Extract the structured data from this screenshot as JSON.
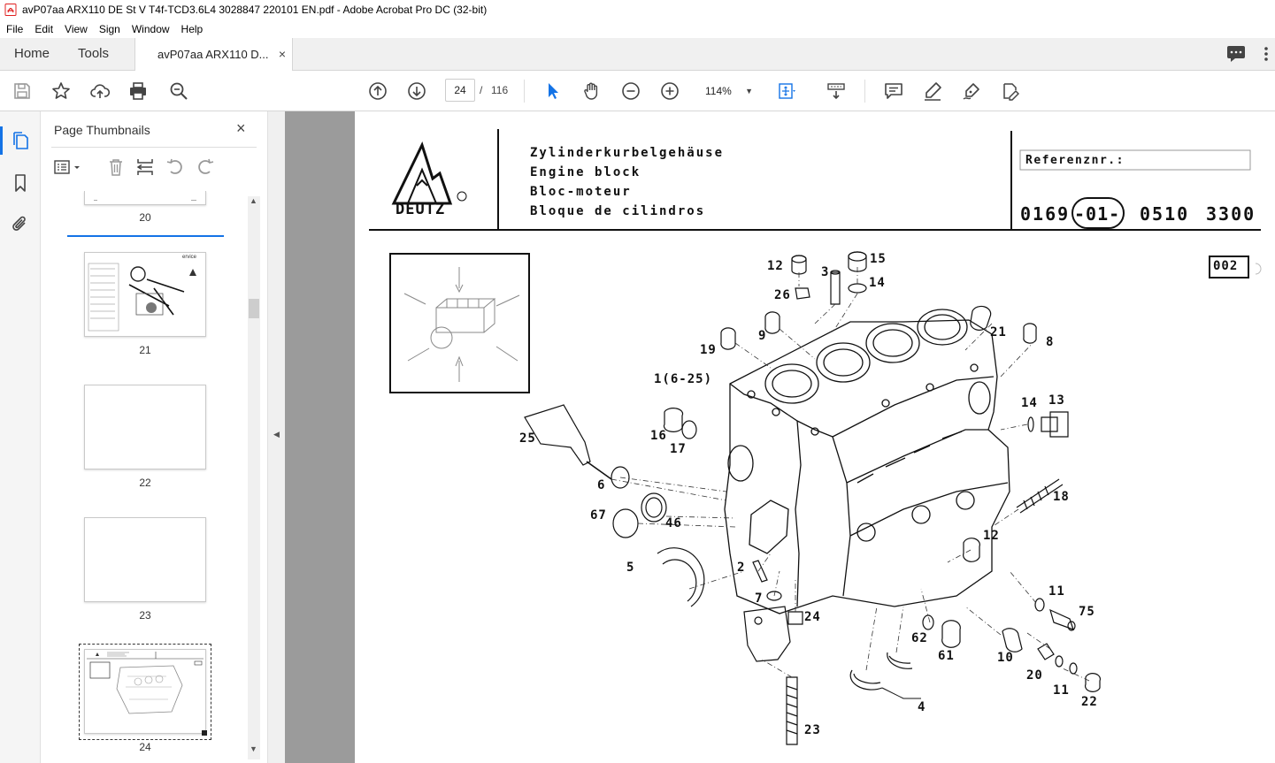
{
  "window": {
    "title": "avP07aa ARX110 DE St V T4f-TCD3.6L4 3028847 220101 EN.pdf - Adobe Acrobat Pro DC (32-bit)"
  },
  "menu": [
    "File",
    "Edit",
    "View",
    "Sign",
    "Window",
    "Help"
  ],
  "tabs": {
    "home": "Home",
    "tools": "Tools",
    "document": "avP07aa ARX110 D...",
    "close": "×"
  },
  "toolbar": {
    "current_page": "24",
    "page_separator": "/",
    "total_pages": "116",
    "zoom": "114%"
  },
  "sidebar": {
    "title": "Page Thumbnails",
    "close": "×",
    "thumbnails": [
      "20",
      "21",
      "22",
      "23",
      "24"
    ],
    "thumb21_text": "ervice"
  },
  "sheet": {
    "brand": "DEUTZ",
    "titles": [
      "Zylinderkurbelgehäuse",
      "Engine block",
      "Bloc-moteur",
      "Bloque de cilindros"
    ],
    "reference_label": "Referenznr.:",
    "ref_part1": "0169",
    "ref_part2": "-01-",
    "ref_part3": "0510",
    "ref_part4": "3300",
    "page_code": "002"
  },
  "callouts": [
    {
      "id": "c12a",
      "text": "12"
    },
    {
      "id": "c3",
      "text": "3"
    },
    {
      "id": "c15",
      "text": "15"
    },
    {
      "id": "c14a",
      "text": "14"
    },
    {
      "id": "c26",
      "text": "26"
    },
    {
      "id": "c9",
      "text": "9"
    },
    {
      "id": "c21",
      "text": "21"
    },
    {
      "id": "c8",
      "text": "8"
    },
    {
      "id": "c19",
      "text": "19"
    },
    {
      "id": "c1",
      "text": "1(6-25)"
    },
    {
      "id": "c14b",
      "text": "14"
    },
    {
      "id": "c13",
      "text": "13"
    },
    {
      "id": "c25",
      "text": "25"
    },
    {
      "id": "c16",
      "text": "16"
    },
    {
      "id": "c17",
      "text": "17"
    },
    {
      "id": "c6",
      "text": "6"
    },
    {
      "id": "c18",
      "text": "18"
    },
    {
      "id": "c67",
      "text": "67"
    },
    {
      "id": "c46",
      "text": "46"
    },
    {
      "id": "c12b",
      "text": "12"
    },
    {
      "id": "c5",
      "text": "5"
    },
    {
      "id": "c2",
      "text": "2"
    },
    {
      "id": "c11a",
      "text": "11"
    },
    {
      "id": "c7",
      "text": "7"
    },
    {
      "id": "c24",
      "text": "24"
    },
    {
      "id": "c75",
      "text": "75"
    },
    {
      "id": "c62",
      "text": "62"
    },
    {
      "id": "c61",
      "text": "61"
    },
    {
      "id": "c10",
      "text": "10"
    },
    {
      "id": "c20",
      "text": "20"
    },
    {
      "id": "c11b",
      "text": "11"
    },
    {
      "id": "c22",
      "text": "22"
    },
    {
      "id": "c4",
      "text": "4"
    },
    {
      "id": "c23",
      "text": "23"
    }
  ],
  "colors": {
    "accent": "#1473e6",
    "doc_background": "#9b9b9b",
    "app_icon": "#e02020"
  }
}
